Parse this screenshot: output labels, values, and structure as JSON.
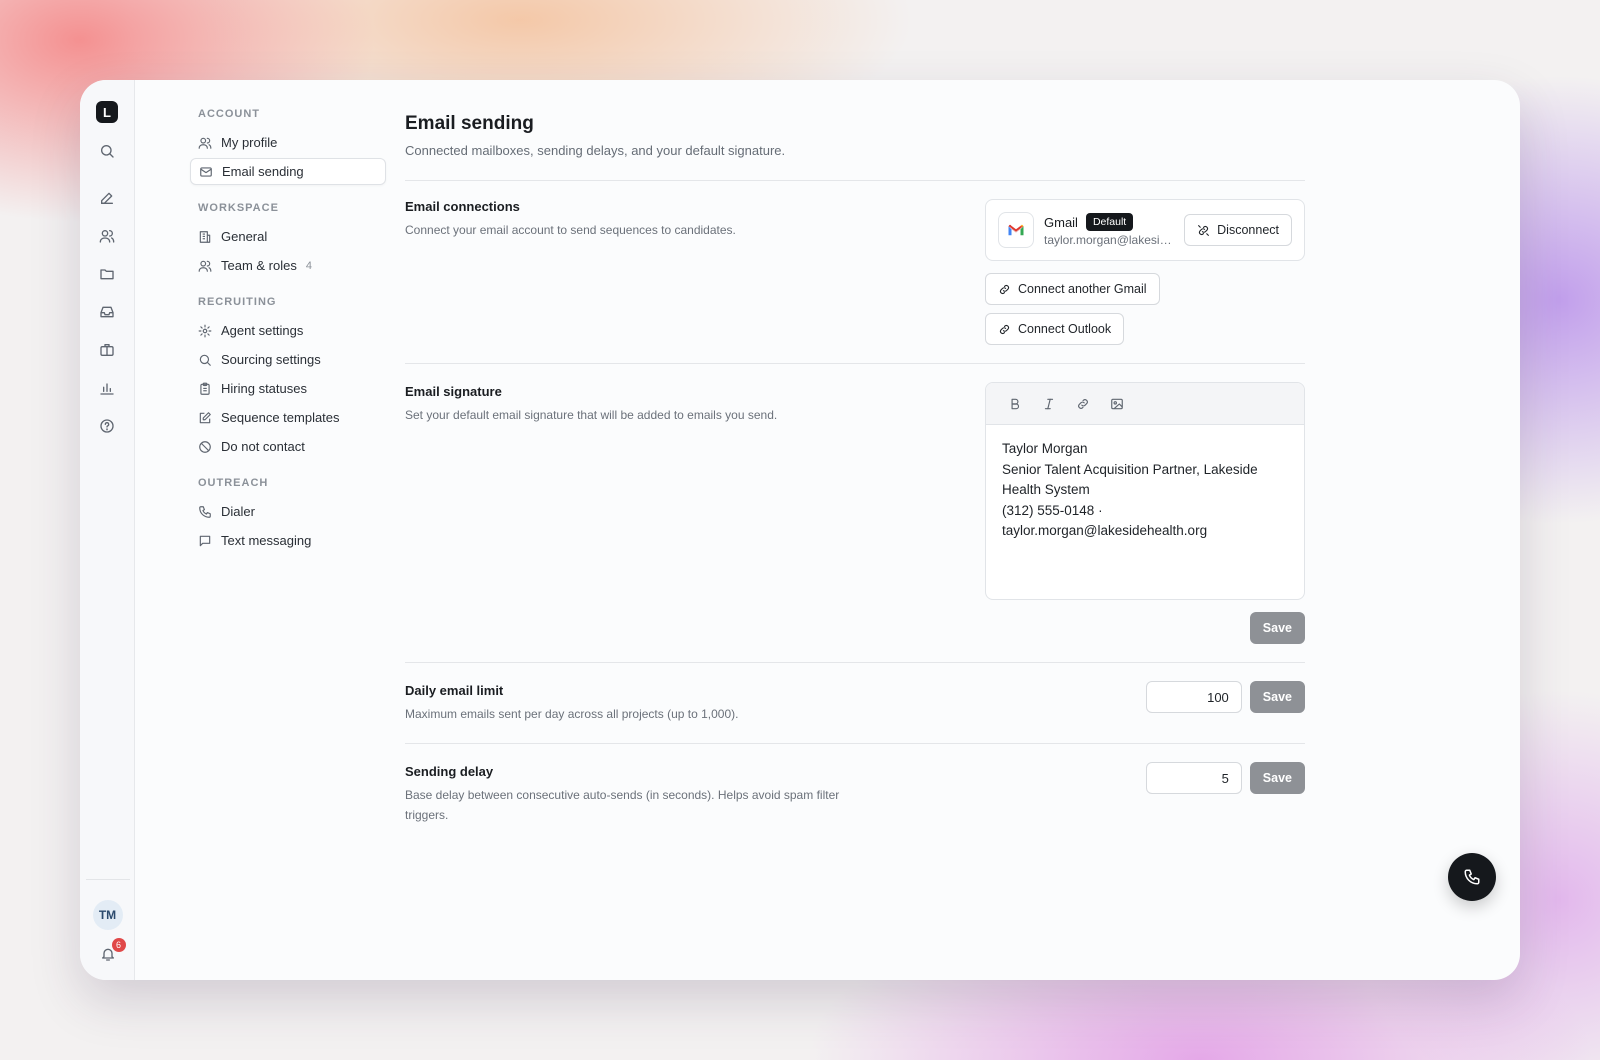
{
  "app": {
    "logo_letter": "L"
  },
  "user": {
    "initials": "TM",
    "notifications": "6"
  },
  "nav": {
    "sections": [
      {
        "label": "ACCOUNT",
        "items": [
          {
            "label": "My profile",
            "icon": "users-icon"
          },
          {
            "label": "Email sending",
            "icon": "mail-icon",
            "active": true
          }
        ]
      },
      {
        "label": "WORKSPACE",
        "items": [
          {
            "label": "General",
            "icon": "building-icon"
          },
          {
            "label": "Team & roles",
            "icon": "users-icon",
            "count": "4"
          }
        ]
      },
      {
        "label": "RECRUITING",
        "items": [
          {
            "label": "Agent settings",
            "icon": "gear-icon"
          },
          {
            "label": "Sourcing settings",
            "icon": "search-icon"
          },
          {
            "label": "Hiring statuses",
            "icon": "clipboard-icon"
          },
          {
            "label": "Sequence templates",
            "icon": "edit-icon"
          },
          {
            "label": "Do not contact",
            "icon": "ban-icon"
          }
        ]
      },
      {
        "label": "OUTREACH",
        "items": [
          {
            "label": "Dialer",
            "icon": "phone-icon"
          },
          {
            "label": "Text messaging",
            "icon": "message-icon"
          }
        ]
      }
    ]
  },
  "page": {
    "title": "Email sending",
    "subtitle": "Connected mailboxes, sending delays, and your default signature."
  },
  "connections": {
    "title": "Email connections",
    "description": "Connect your email account to send sequences to candidates.",
    "account": {
      "provider": "Gmail",
      "badge": "Default",
      "email": "taylor.morgan@lakesidehealth.org",
      "disconnect_label": "Disconnect"
    },
    "connect_gmail_label": "Connect another Gmail",
    "connect_outlook_label": "Connect Outlook"
  },
  "signature": {
    "title": "Email signature",
    "description": "Set your default email signature that will be added to emails you send.",
    "lines": [
      "Taylor Morgan",
      "Senior Talent Acquisition Partner, Lakeside Health System",
      "(312) 555-0148 · taylor.morgan@lakesidehealth.org"
    ],
    "save_label": "Save"
  },
  "daily_limit": {
    "title": "Daily email limit",
    "description": "Maximum emails sent per day across all projects (up to 1,000).",
    "value": "100",
    "save_label": "Save"
  },
  "sending_delay": {
    "title": "Sending delay",
    "description": "Base delay between consecutive auto-sends (in seconds). Helps avoid spam filter triggers.",
    "value": "5",
    "save_label": "Save"
  }
}
